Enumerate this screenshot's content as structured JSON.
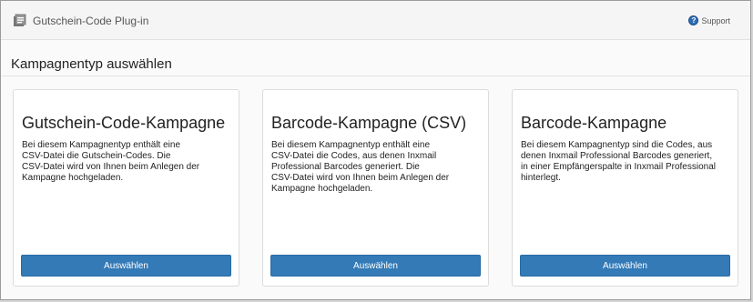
{
  "header": {
    "app_title": "Gutschein-Code Plug-in",
    "app_logo_icon": "coupon-icon",
    "support_label": "Support",
    "support_icon": "help-icon"
  },
  "main": {
    "section_title": "Kampagnentyp auswählen",
    "cards": [
      {
        "title": "Gutschein-Code-Kampagne",
        "lines": [
          "Bei diesem Kampagnentyp enthält eine",
          "CSV-Datei die Gutschein-Codes. Die",
          "CSV-Datei wird von Ihnen beim Anlegen der",
          "Kampagne hochgeladen."
        ],
        "button_label": "Auswählen"
      },
      {
        "title": "Barcode-Kampagne (CSV)",
        "lines": [
          "Bei diesem Kampagnentyp enthält eine",
          "CSV-Datei die Codes, aus denen Inxmail",
          "Professional Barcodes generiert. Die",
          "CSV-Datei wird von Ihnen beim Anlegen der",
          "Kampagne hochgeladen."
        ],
        "button_label": "Auswählen"
      },
      {
        "title": "Barcode-Kampagne",
        "lines": [
          "Bei diesem Kampagnentyp sind die Codes, aus",
          "denen Inxmail Professional Barcodes generiert,",
          "in einer Empfängerspalte in Inxmail Professional",
          "hinterlegt."
        ],
        "button_label": "Auswählen"
      }
    ]
  },
  "colors": {
    "primary_button": "#337ab7",
    "background": "#fafafa"
  }
}
